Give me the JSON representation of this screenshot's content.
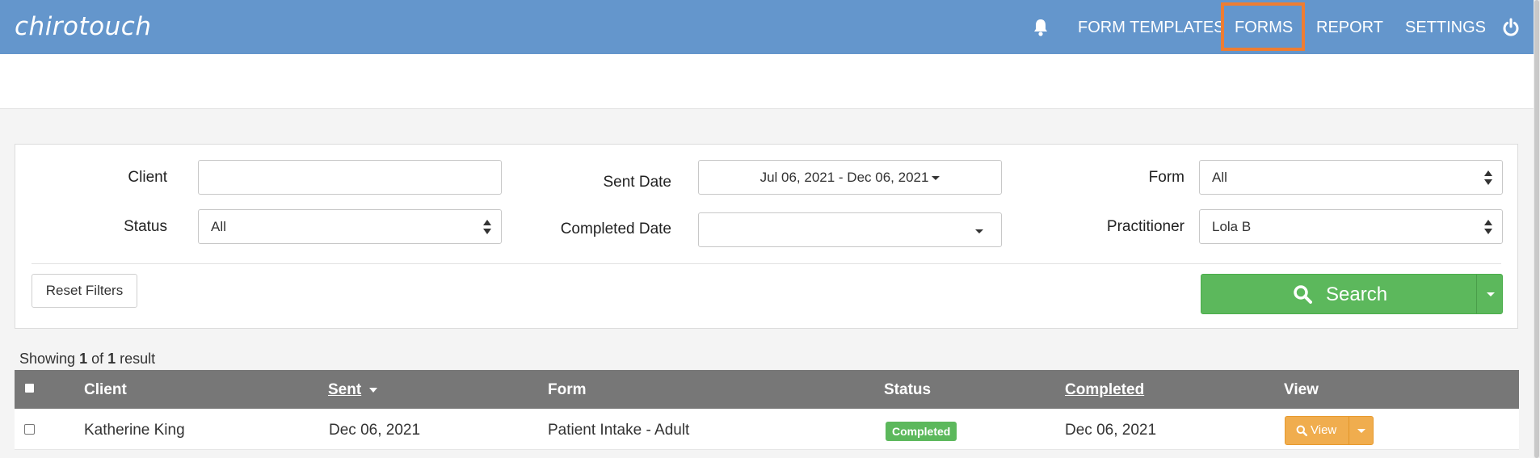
{
  "brand": {
    "logo_text": "chirotouch"
  },
  "nav": {
    "items": [
      {
        "label": "FORM TEMPLATES"
      },
      {
        "label": "FORMS"
      },
      {
        "label": "REPORT"
      },
      {
        "label": "SETTINGS"
      }
    ],
    "highlight_color": "#ee7d32",
    "bar_color": "#6496cc"
  },
  "filters": {
    "client_label": "Client",
    "client_value": "",
    "sent_date_label": "Sent Date",
    "sent_date_value": "Jul 06, 2021 - Dec 06, 2021",
    "form_label": "Form",
    "form_value": "All",
    "status_label": "Status",
    "status_value": "All",
    "completed_date_label": "Completed Date",
    "completed_date_value": "",
    "practitioner_label": "Practitioner",
    "practitioner_value": "Lola B",
    "reset_label": "Reset Filters",
    "search_label": "Search"
  },
  "results": {
    "showing_prefix": "Showing",
    "shown": "1",
    "of_word": "of",
    "total": "1",
    "suffix": "result"
  },
  "table": {
    "columns": {
      "client": "Client",
      "sent": "Sent",
      "form": "Form",
      "status": "Status",
      "completed": "Completed",
      "view": "View"
    },
    "rows": [
      {
        "client": "Katherine King",
        "sent": "Dec 06, 2021",
        "form": "Patient Intake - Adult",
        "status": "Completed",
        "completed": "Dec 06, 2021",
        "view_label": "View"
      }
    ]
  }
}
